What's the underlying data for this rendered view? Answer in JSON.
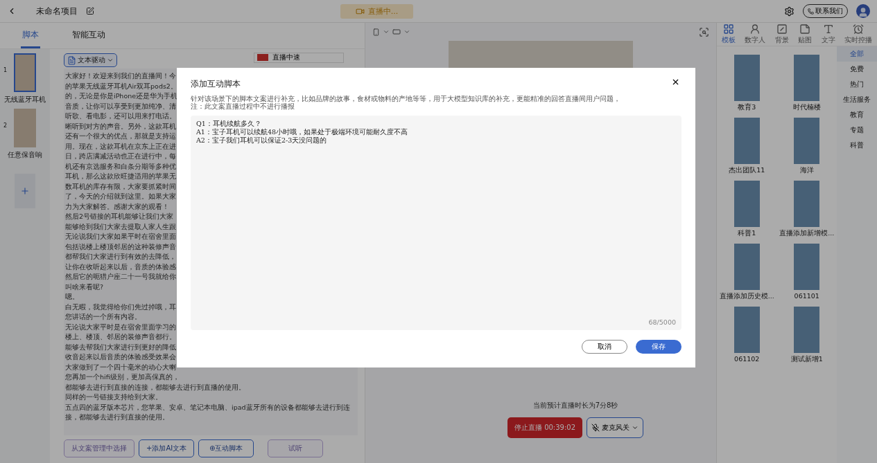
{
  "top_bar": {
    "title": "未命名项目",
    "status": "直播中...",
    "contact_button": "联系我们"
  },
  "left_tabs": [
    {
      "label": "脚本",
      "selected": true
    },
    {
      "label": "智能互动",
      "selected": false
    }
  ],
  "scenes": [
    {
      "index": "1",
      "name": "无线蓝牙耳机",
      "selected": true
    },
    {
      "index": "2",
      "name": "任意保音响",
      "selected": false
    }
  ],
  "editor": {
    "mode": "文本驱动",
    "speed": "直播中速",
    "lines": [
      "大家好！欢迎来到我们的直播间！今",
      "的苹果无线蓝牙耳机Air双耳pods2。",
      "的，无论是你是iPhone还是华为手机",
      "音质，让你可以享受到更加纯净、清",
      "听歌、看电影，还可以用来打电话。",
      "晰听到对方的声音。另外，这款耳机",
      "还有一个很大的优点，那就是支持运",
      "用。现在，这款耳机在京东上正在进",
      "日，跨店满减活动也正在进行中，每",
      "机还有京选服务和白条分期等多种优",
      "耳机，那么这款欣旺捷适用的苹果无",
      "数耳机的库存有限，大家要抓紧时间",
      "了，今天的介绍就到这里。如果大家",
      "力为大家解答。感谢大家的观看！",
      "然后2号链接的耳机能够让我们大家",
      "能够给到我们大家去提取人家人生跟",
      "无论说我们大家如果平时在宿舍里面",
      "包括说楼上楼顶邻居的这种装修声音",
      "都帮我们大家进行到有效的去降低，",
      "让你在收听起来以后，音质的体验感",
      "然后它的呃猎户座二十一号我就给你",
      "叫啥来看呢?",
      "嗯。",
      "白无暇，我觉得给你们先过掉哦，耳",
      "您讲话的一个所有内容。",
      "无论说大家平时是在宿舍里面学习的",
      "楼上、楼顶、邻居的装修声音都行。",
      "能够去帮我们大家进行到更好的降低",
      "收音起来以后音质的体验感受效果会",
      "大家做到了一个四十毫米的动心大喇",
      "您再加一个hifi级别，更加高保真的，",
      "都能够去进行到直接的连接，都能够去进行到直播的使用。",
      "同样的一号链接支持给到大家。",
      "五点四的蓝牙版本芯片，您苹果、安卓、笔记本电脑、ipad蓝牙所有的设备都能够去进行到连",
      "接，都能够去进行到直接的使用。"
    ]
  },
  "editor_buttons": [
    {
      "label": "从文案管理中选择",
      "disabled": true
    },
    {
      "label": "+添加AI文本",
      "disabled": false
    },
    {
      "label": "⊕互动脚本",
      "disabled": false
    },
    {
      "label": "试听",
      "disabled": true
    }
  ],
  "preview": {
    "duration": "当前预计直播时长为7分8秒",
    "stop_button": "停止直播 00:39:02",
    "mic": "麦克风关"
  },
  "right_tabs": [
    {
      "label": "模板",
      "kind": "grid",
      "selected": true
    },
    {
      "label": "数字人",
      "kind": "person",
      "selected": false
    },
    {
      "label": "背景",
      "kind": "background",
      "selected": false
    },
    {
      "label": "贴图",
      "kind": "sticker",
      "selected": false
    },
    {
      "label": "文字",
      "kind": "text",
      "selected": false
    },
    {
      "label": "实时控播",
      "kind": "clock",
      "selected": false
    }
  ],
  "templates": [
    {
      "name": "教育3"
    },
    {
      "name": "时代楠楼"
    },
    {
      "name": "杰出团队11"
    },
    {
      "name": "海洋"
    },
    {
      "name": "科普1"
    },
    {
      "name": "直播添加新增模..."
    },
    {
      "name": "直播添加历史模..."
    },
    {
      "name": "061101"
    },
    {
      "name": "061102"
    },
    {
      "name": "测试新增1"
    }
  ],
  "categories": [
    {
      "label": "全部",
      "selected": true
    },
    {
      "label": "免费",
      "selected": false
    },
    {
      "label": "热门",
      "selected": false
    },
    {
      "label": "生活服务",
      "selected": false
    },
    {
      "label": "教育",
      "selected": false
    },
    {
      "label": "专题",
      "selected": false
    },
    {
      "label": "科普",
      "selected": false
    }
  ],
  "dialog": {
    "title": "添加互动脚本",
    "description": "针对该场景下的脚本文案进行补充，比如品牌的故事，食材或物料的产地等等，用于大模型知识库的补充，更能精准的回答直播间用户问题，",
    "note": "注：此文案直播过程中不进行播报",
    "value": "Q1：耳机续航多久？\nA1：宝子耳机可以续航48小时哦，如果处于极端环境可能耐久度不高\nA2：宝子我们耳机可以保证2-3天没问题的",
    "counter": "68/5000",
    "cancel": "取消",
    "save": "保存"
  }
}
